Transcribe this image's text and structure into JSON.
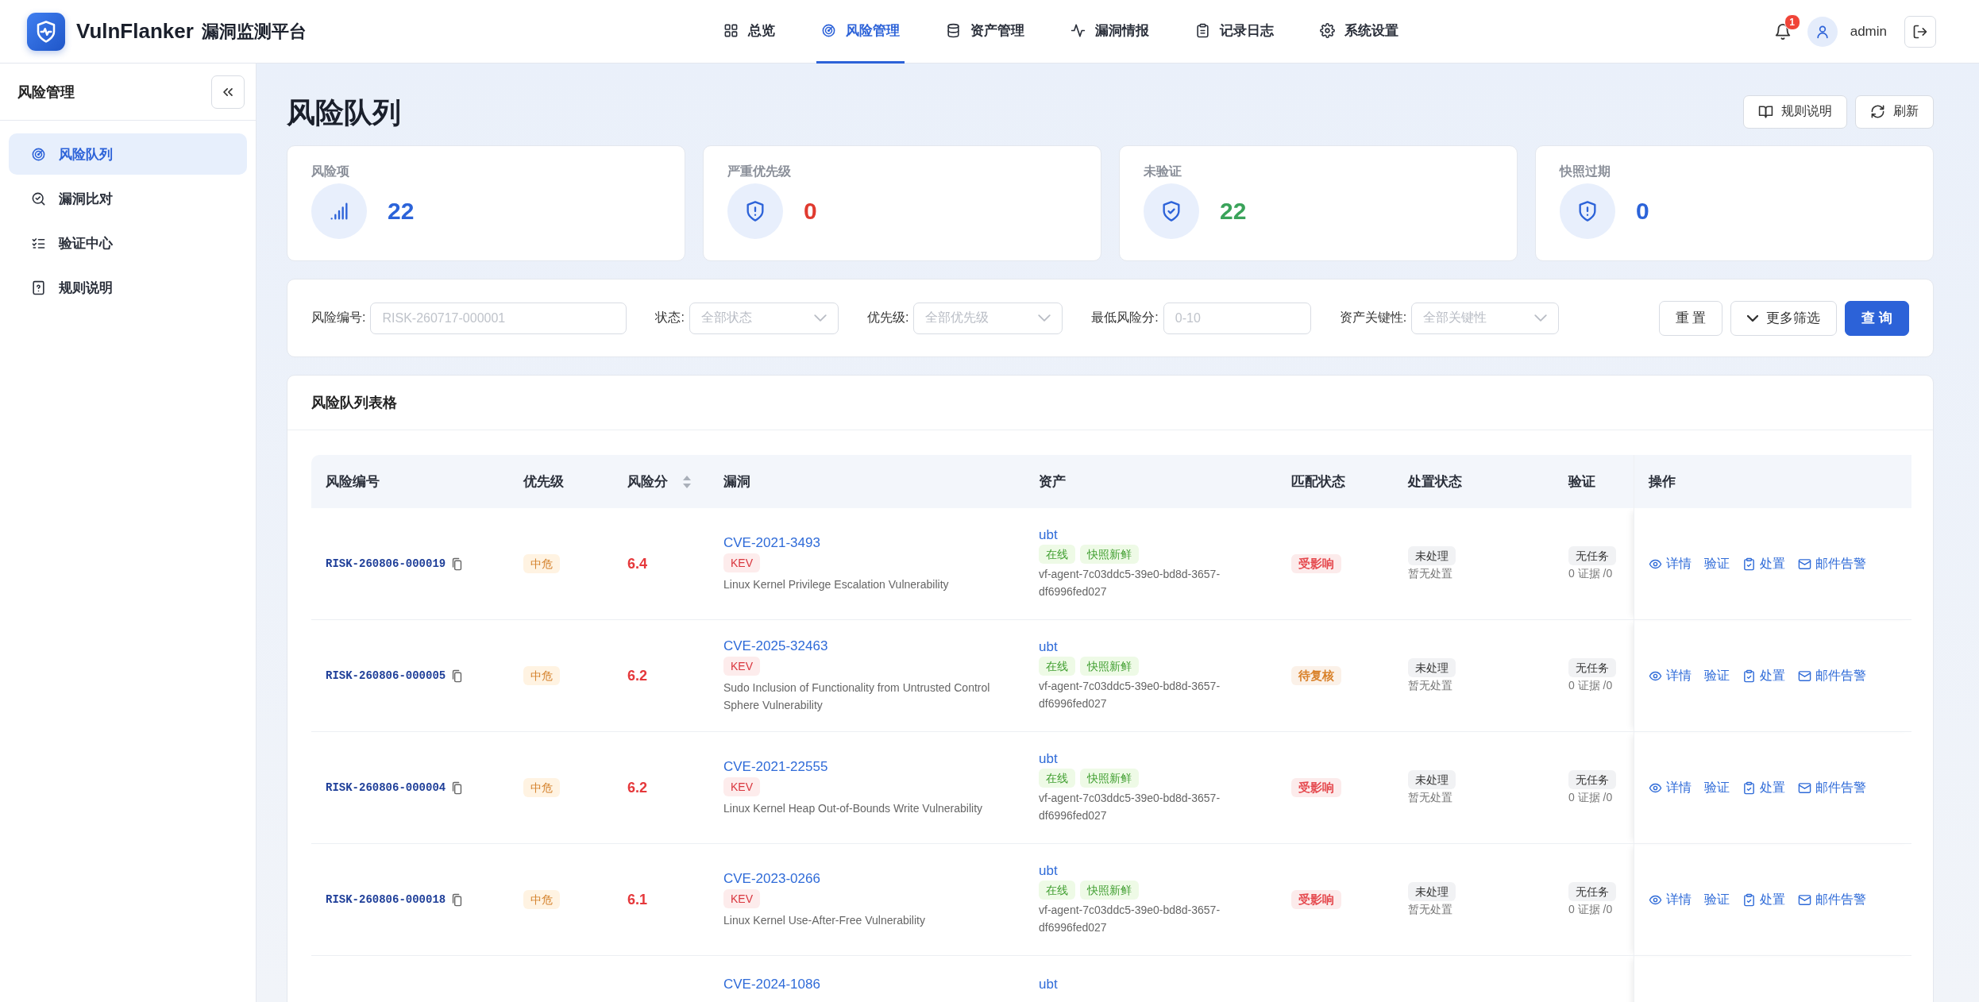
{
  "header": {
    "brand": "VulnFlanker",
    "subtitle": "漏洞监测平台",
    "nav": [
      {
        "label": "总览",
        "selected": false
      },
      {
        "label": "风险管理",
        "selected": true
      },
      {
        "label": "资产管理",
        "selected": false
      },
      {
        "label": "漏洞情报",
        "selected": false
      },
      {
        "label": "记录日志",
        "selected": false
      },
      {
        "label": "系统设置",
        "selected": false
      }
    ],
    "notification_count": "1",
    "user": "admin"
  },
  "sidebar": {
    "title": "风险管理",
    "items": [
      {
        "label": "风险队列",
        "selected": true
      },
      {
        "label": "漏洞比对",
        "selected": false
      },
      {
        "label": "验证中心",
        "selected": false
      },
      {
        "label": "规则说明",
        "selected": false
      }
    ]
  },
  "page": {
    "title": "风险队列",
    "actions": [
      "规则说明",
      "刷新"
    ]
  },
  "stats": [
    {
      "label": "风险项",
      "value": "22",
      "color": "#2b63d9"
    },
    {
      "label": "严重优先级",
      "value": "0",
      "color": "#e03a2f"
    },
    {
      "label": "未验证",
      "value": "22",
      "color": "#3aa35a"
    },
    {
      "label": "快照过期",
      "value": "0",
      "color": "#2b63d9"
    }
  ],
  "filters": {
    "fields": [
      {
        "label": "风险编号:",
        "kind": "input",
        "placeholder": "RISK-260717-000001"
      },
      {
        "label": "状态:",
        "kind": "select",
        "placeholder": "全部状态"
      },
      {
        "label": "优先级:",
        "kind": "select",
        "placeholder": "全部优先级"
      },
      {
        "label": "最低风险分:",
        "kind": "input",
        "placeholder": "0-10"
      },
      {
        "label": "资产关键性:",
        "kind": "select",
        "placeholder": "全部关键性"
      }
    ],
    "buttons": [
      {
        "label": "重 置",
        "kind": "default"
      },
      {
        "label": "更多筛选",
        "kind": "toggle"
      },
      {
        "label": "查 询",
        "kind": "primary"
      }
    ]
  },
  "table": {
    "title": "风险队列表格",
    "columns": [
      {
        "label": "风险编号",
        "sortable": false
      },
      {
        "label": "优先级",
        "sortable": false
      },
      {
        "label": "风险分",
        "sortable": true
      },
      {
        "label": "漏洞",
        "sortable": false
      },
      {
        "label": "资产",
        "sortable": false
      },
      {
        "label": "匹配状态",
        "sortable": false
      },
      {
        "label": "处置状态",
        "sortable": false
      },
      {
        "label": "验证",
        "sortable": false
      },
      {
        "label": "操作",
        "sortable": false
      }
    ],
    "rows": [
      {
        "risk_id": "RISK-260806-000019",
        "priority": "中危",
        "score": "6.4",
        "cve": "CVE-2021-3493",
        "tag": "KEV",
        "title": "Linux Kernel Privilege Escalation Vulnerability",
        "asset": "ubt",
        "asset_tags": [
          "在线",
          "快照新鲜"
        ],
        "agent": "vf-agent-7c03ddc5-39e0-bd8d-3657-df6996fed027",
        "match": {
          "label": "受影响",
          "color": "#e5484d"
        },
        "disposition": "未处理",
        "disposition_note": "暂无处置",
        "verify": "无任务",
        "evidence": "0 证据 /0",
        "actions": [
          "详情",
          "验证",
          "处置",
          "邮件告警"
        ]
      },
      {
        "risk_id": "RISK-260806-000005",
        "priority": "中危",
        "score": "6.2",
        "cve": "CVE-2025-32463",
        "tag": "KEV",
        "title": "Sudo Inclusion of Functionality from Untrusted Control Sphere Vulnerability",
        "asset": "ubt",
        "asset_tags": [
          "在线",
          "快照新鲜"
        ],
        "agent": "vf-agent-7c03ddc5-39e0-bd8d-3657-df6996fed027",
        "match": {
          "label": "待复核",
          "color": "#d9822b"
        },
        "disposition": "未处理",
        "disposition_note": "暂无处置",
        "verify": "无任务",
        "evidence": "0 证据 /0",
        "actions": [
          "详情",
          "验证",
          "处置",
          "邮件告警"
        ]
      },
      {
        "risk_id": "RISK-260806-000004",
        "priority": "中危",
        "score": "6.2",
        "cve": "CVE-2021-22555",
        "tag": "KEV",
        "title": "Linux Kernel Heap Out-of-Bounds Write Vulnerability",
        "asset": "ubt",
        "asset_tags": [
          "在线",
          "快照新鲜"
        ],
        "agent": "vf-agent-7c03ddc5-39e0-bd8d-3657-df6996fed027",
        "match": {
          "label": "受影响",
          "color": "#e5484d"
        },
        "disposition": "未处理",
        "disposition_note": "暂无处置",
        "verify": "无任务",
        "evidence": "0 证据 /0",
        "actions": [
          "详情",
          "验证",
          "处置",
          "邮件告警"
        ]
      },
      {
        "risk_id": "RISK-260806-000018",
        "priority": "中危",
        "score": "6.1",
        "cve": "CVE-2023-0266",
        "tag": "KEV",
        "title": "Linux Kernel Use-After-Free Vulnerability",
        "asset": "ubt",
        "asset_tags": [
          "在线",
          "快照新鲜"
        ],
        "agent": "vf-agent-7c03ddc5-39e0-bd8d-3657-df6996fed027",
        "match": {
          "label": "受影响",
          "color": "#e5484d"
        },
        "disposition": "未处理",
        "disposition_note": "暂无处置",
        "verify": "无任务",
        "evidence": "0 证据 /0",
        "actions": [
          "详情",
          "验证",
          "处置",
          "邮件告警"
        ]
      },
      {
        "cve": "CVE-2024-1086",
        "asset": "ubt"
      }
    ]
  }
}
